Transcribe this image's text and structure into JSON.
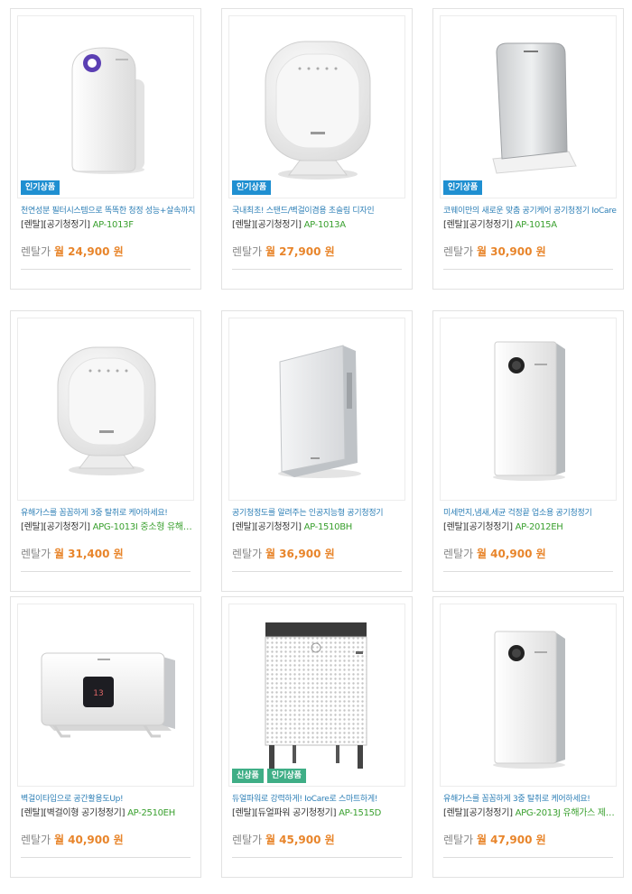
{
  "products": [
    {
      "badges": [
        "인기상품"
      ],
      "desc": "천연성분 필터시스템으로 똑똑한 청정 성능+살속까지",
      "category": "[렌탈][공기청정기]",
      "model": "AP-1013F",
      "price_label": "렌탈가",
      "price": "월 24,900 원",
      "image_icon": "air-purifier-tall-purple-dial"
    },
    {
      "badges": [
        "인기상품"
      ],
      "desc": "국내최초! 스탠드/벽걸이겸용 초슬림 디자인",
      "category": "[렌탈][공기청정기]",
      "model": "AP-1013A",
      "price_label": "렌탈가",
      "price": "월 27,900 원",
      "image_icon": "air-purifier-round-square"
    },
    {
      "badges": [
        "인기상품"
      ],
      "desc": "코웨이만의 새로운 맞춤 공기케어 공기청정기 IoCare",
      "category": "[렌탈][공기청정기]",
      "model": "AP-1015A",
      "price_label": "렌탈가",
      "price": "월 30,900 원",
      "image_icon": "air-purifier-silver-tower"
    },
    {
      "badges": [],
      "desc": "유해가스를 꼼꼼하게 3중 탈취로 케어하세요!",
      "category": "[렌탈][공기청정기]",
      "model": "APG-1013I 중소형 유해…",
      "price_label": "렌탈가",
      "price": "월 31,400 원",
      "image_icon": "air-purifier-round-square"
    },
    {
      "badges": [],
      "desc": "공기청정도를 알려주는 인공지능형 공기청정기",
      "category": "[렌탈][공기청정기]",
      "model": "AP-1510BH",
      "price_label": "렌탈가",
      "price": "월 36,900 원",
      "image_icon": "air-purifier-flat-panel"
    },
    {
      "badges": [],
      "desc": "미세먼지,냄새,세균 걱정끝 업소용 공기청정기",
      "category": "[렌탈][공기청정기]",
      "model": "AP-2012EH",
      "price_label": "렌탈가",
      "price": "월 40,900 원",
      "image_icon": "air-purifier-tall-dial"
    },
    {
      "badges": [],
      "desc": "벽걸이타입으로 공간활용도Up!",
      "category": "[렌탈][벽걸이형 공기청정기]",
      "model": "AP-2510EH",
      "price_label": "렌탈가",
      "price": "월 40,900 원",
      "image_icon": "air-purifier-wall-mounted"
    },
    {
      "badges": [
        "신상품",
        "인기상품"
      ],
      "desc": "듀얼파워로 강력하게! IoCare로 스마트하게!",
      "category": "[렌탈][듀얼파워 공기청정기]",
      "model": "AP-1515D",
      "price_label": "렌탈가",
      "price": "월 45,900 원",
      "image_icon": "air-purifier-mesh-cube"
    },
    {
      "badges": [],
      "desc": "유해가스를 꼼꼼하게 3중 탈취로 케어하세요!",
      "category": "[렌탈][공기청정기]",
      "model": "APG-2013J 유해가스 제…",
      "price_label": "렌탈가",
      "price": "월 47,900 원",
      "image_icon": "air-purifier-tall-dial"
    }
  ],
  "colors": {
    "accent_price": "#e8852b",
    "model_green": "#3aa02f",
    "desc_blue": "#2d7fb6",
    "badge_hot": "#1f8fd1",
    "badge_new": "#3fae86"
  }
}
